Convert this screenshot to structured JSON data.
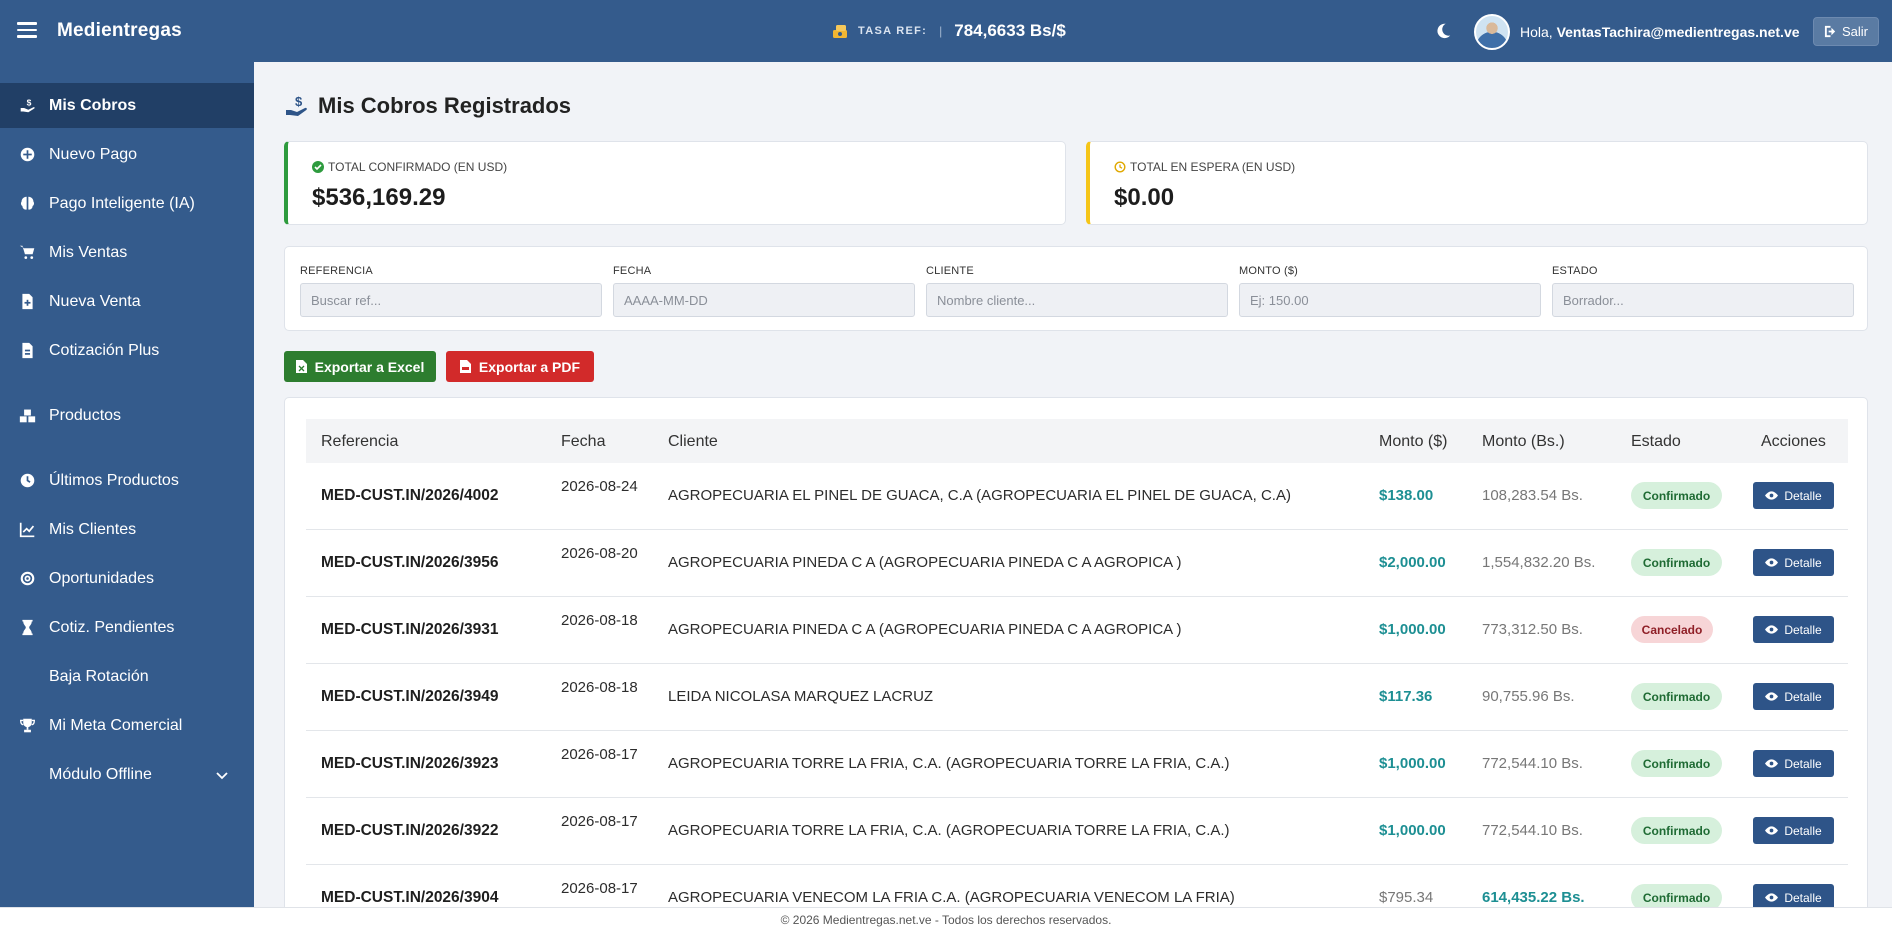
{
  "header": {
    "brand": "Medientregas",
    "rate_label": "TASA REF:",
    "rate_separator": "|",
    "rate_value": "784,6633 Bs/$",
    "greeting": "Hola,",
    "user_email": "VentasTachira@medientregas.net.ve",
    "logout_label": "Salir"
  },
  "sidebar": {
    "items": [
      {
        "label": "Mis Cobros",
        "icon": "hand-money-icon",
        "active": true
      },
      {
        "label": "Nuevo Pago",
        "icon": "plus-circle-icon"
      },
      {
        "label": "Pago Inteligente (IA)",
        "icon": "brain-icon"
      },
      {
        "label": "Mis Ventas",
        "icon": "cart-icon"
      },
      {
        "label": "Nueva Venta",
        "icon": "file-plus-icon"
      },
      {
        "label": "Cotización Plus",
        "icon": "file-invoice-icon"
      },
      {
        "label": "Productos",
        "icon": "boxes-icon"
      },
      {
        "label": "Últimos Productos",
        "icon": "clock-icon"
      },
      {
        "label": "Mis Clientes",
        "icon": "chart-line-icon"
      },
      {
        "label": "Oportunidades",
        "icon": "bullseye-icon"
      },
      {
        "label": "Cotiz. Pendientes",
        "icon": "hourglass-icon"
      },
      {
        "label": "Baja Rotación",
        "icon": ""
      },
      {
        "label": "Mi Meta Comercial",
        "icon": "trophy-icon"
      },
      {
        "label": "Módulo Offline",
        "icon": "",
        "has_chevron": true
      }
    ]
  },
  "page": {
    "title": "Mis Cobros Registrados"
  },
  "summary": {
    "confirmed_label": "TOTAL CONFIRMADO (EN USD)",
    "confirmed_amount": "$536,169.29",
    "confirmed_color": "#2e9b3e",
    "pending_label": "TOTAL EN ESPERA (EN USD)",
    "pending_amount": "$0.00",
    "pending_color": "#f5c518"
  },
  "filters": {
    "referencia": {
      "label": "REFERENCIA",
      "placeholder": "Buscar ref..."
    },
    "fecha": {
      "label": "FECHA",
      "placeholder": "AAAA-MM-DD"
    },
    "cliente": {
      "label": "CLIENTE",
      "placeholder": "Nombre cliente..."
    },
    "monto": {
      "label": "MONTO ($)",
      "placeholder": "Ej: 150.00"
    },
    "estado": {
      "label": "ESTADO",
      "placeholder": "Borrador..."
    }
  },
  "actions": {
    "excel_label": "Exportar a Excel",
    "pdf_label": "Exportar a PDF"
  },
  "table": {
    "columns": [
      "Referencia",
      "Fecha",
      "Cliente",
      "Monto ($)",
      "Monto (Bs.)",
      "Estado",
      "Acciones"
    ],
    "detail_label": "Detalle",
    "rows": [
      {
        "ref": "MED-CUST.IN/2026/4002",
        "fecha": "2026-08-24",
        "cliente": "AGROPECUARIA EL PINEL DE GUACA, C.A (AGROPECUARIA EL PINEL DE GUACA, C.A)",
        "usd": "$138.00",
        "bs": "108,283.54 Bs.",
        "estado": "Confirmado",
        "estado_type": "ok",
        "usd_emphasis": true
      },
      {
        "ref": "MED-CUST.IN/2026/3956",
        "fecha": "2026-08-20",
        "cliente": "AGROPECUARIA PINEDA C A (AGROPECUARIA PINEDA C A AGROPICA )",
        "usd": "$2,000.00",
        "bs": "1,554,832.20 Bs.",
        "estado": "Confirmado",
        "estado_type": "ok",
        "usd_emphasis": true
      },
      {
        "ref": "MED-CUST.IN/2026/3931",
        "fecha": "2026-08-18",
        "cliente": "AGROPECUARIA PINEDA C A (AGROPECUARIA PINEDA C A AGROPICA )",
        "usd": "$1,000.00",
        "bs": "773,312.50 Bs.",
        "estado": "Cancelado",
        "estado_type": "cancel",
        "usd_emphasis": true
      },
      {
        "ref": "MED-CUST.IN/2026/3949",
        "fecha": "2026-08-18",
        "cliente": "LEIDA NICOLASA MARQUEZ LACRUZ",
        "usd": "$117.36",
        "bs": "90,755.96 Bs.",
        "estado": "Confirmado",
        "estado_type": "ok",
        "usd_emphasis": true
      },
      {
        "ref": "MED-CUST.IN/2026/3923",
        "fecha": "2026-08-17",
        "cliente": "AGROPECUARIA TORRE LA FRIA, C.A. (AGROPECUARIA TORRE LA FRIA, C.A.)",
        "usd": "$1,000.00",
        "bs": "772,544.10 Bs.",
        "estado": "Confirmado",
        "estado_type": "ok",
        "usd_emphasis": true
      },
      {
        "ref": "MED-CUST.IN/2026/3922",
        "fecha": "2026-08-17",
        "cliente": "AGROPECUARIA TORRE LA FRIA, C.A. (AGROPECUARIA TORRE LA FRIA, C.A.)",
        "usd": "$1,000.00",
        "bs": "772,544.10 Bs.",
        "estado": "Confirmado",
        "estado_type": "ok",
        "usd_emphasis": true
      },
      {
        "ref": "MED-CUST.IN/2026/3904",
        "fecha": "2026-08-17",
        "cliente": "AGROPECUARIA VENECOM LA FRIA C.A. (AGROPECUARIA VENECOM LA FRIA)",
        "usd": "$795.34",
        "bs": "614,435.22 Bs.",
        "estado": "Confirmado",
        "estado_type": "ok",
        "usd_emphasis": false
      }
    ]
  },
  "footer": {
    "text": "© 2026 Medientregas.net.ve - Todos los derechos reservados."
  }
}
